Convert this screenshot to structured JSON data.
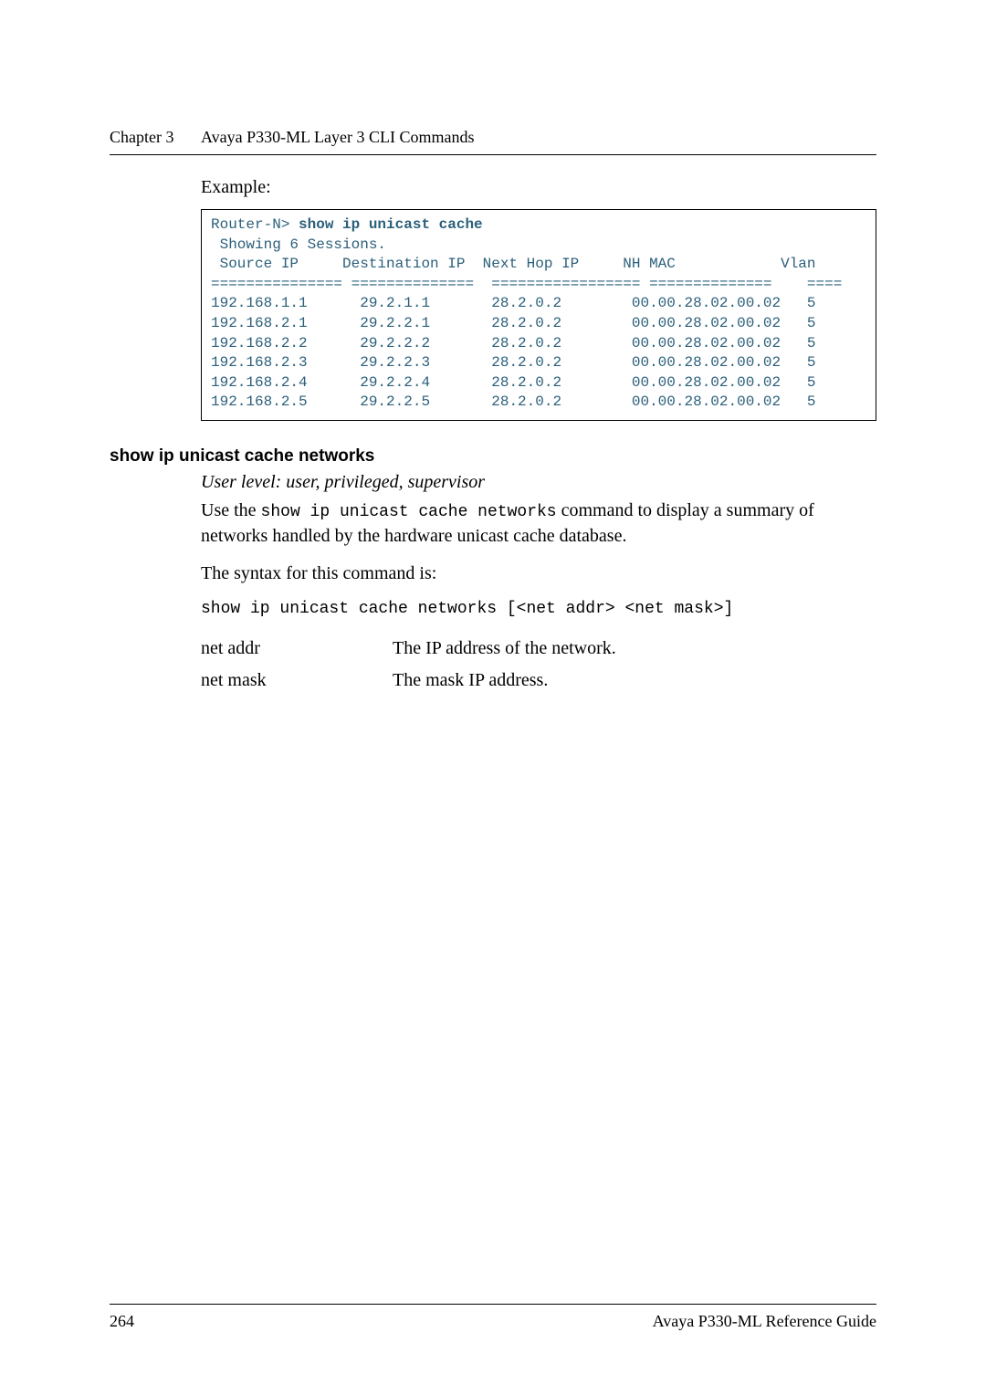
{
  "header": {
    "chapter": "Chapter 3",
    "title": "Avaya P330-ML Layer 3 CLI Commands"
  },
  "example_label": "Example:",
  "code": {
    "prompt": "Router-N> ",
    "command_bold": "show ip unicast cache",
    "line_sessions": " Showing 6 Sessions.",
    "cols_header": " Source IP     Destination IP  Next Hop IP     NH MAC            Vlan",
    "cols_divider": "=============== ==============  ================= ==============    ====",
    "rows": [
      "192.168.1.1      29.2.1.1       28.2.0.2        00.00.28.02.00.02   5",
      "192.168.2.1      29.2.2.1       28.2.0.2        00.00.28.02.00.02   5",
      "192.168.2.2      29.2.2.2       28.2.0.2        00.00.28.02.00.02   5",
      "192.168.2.3      29.2.2.3       28.2.0.2        00.00.28.02.00.02   5",
      "192.168.2.4      29.2.2.4       28.2.0.2        00.00.28.02.00.02   5",
      "192.168.2.5      29.2.2.5       28.2.0.2        00.00.28.02.00.02   5"
    ]
  },
  "section": {
    "heading": "show ip unicast cache networks",
    "userlevel": "User level: user, privileged, supervisor",
    "body_pre": "Use the ",
    "body_cmd": "show ip unicast cache networks",
    "body_post": " command to display a summary of networks handled by the hardware unicast cache database.",
    "syntax_label": "The syntax for this command is:",
    "syntax_cmd": "show ip unicast cache networks [<net addr> <net mask>]",
    "params": [
      {
        "name": "net addr",
        "desc": "The IP address of the network."
      },
      {
        "name": "net mask",
        "desc": "The mask IP address."
      }
    ]
  },
  "footer": {
    "page": "264",
    "ref": "Avaya P330-ML Reference Guide"
  },
  "chart_data": {
    "type": "table",
    "title": "show ip unicast cache",
    "columns": [
      "Source IP",
      "Destination IP",
      "Next Hop IP",
      "NH MAC",
      "Vlan"
    ],
    "rows": [
      [
        "192.168.1.1",
        "29.2.1.1",
        "28.2.0.2",
        "00.00.28.02.00.02",
        5
      ],
      [
        "192.168.2.1",
        "29.2.2.1",
        "28.2.0.2",
        "00.00.28.02.00.02",
        5
      ],
      [
        "192.168.2.2",
        "29.2.2.2",
        "28.2.0.2",
        "00.00.28.02.00.02",
        5
      ],
      [
        "192.168.2.3",
        "29.2.2.3",
        "28.2.0.2",
        "00.00.28.02.00.02",
        5
      ],
      [
        "192.168.2.4",
        "29.2.2.4",
        "28.2.0.2",
        "00.00.28.02.00.02",
        5
      ],
      [
        "192.168.2.5",
        "29.2.2.5",
        "28.2.0.2",
        "00.00.28.02.00.02",
        5
      ]
    ]
  }
}
